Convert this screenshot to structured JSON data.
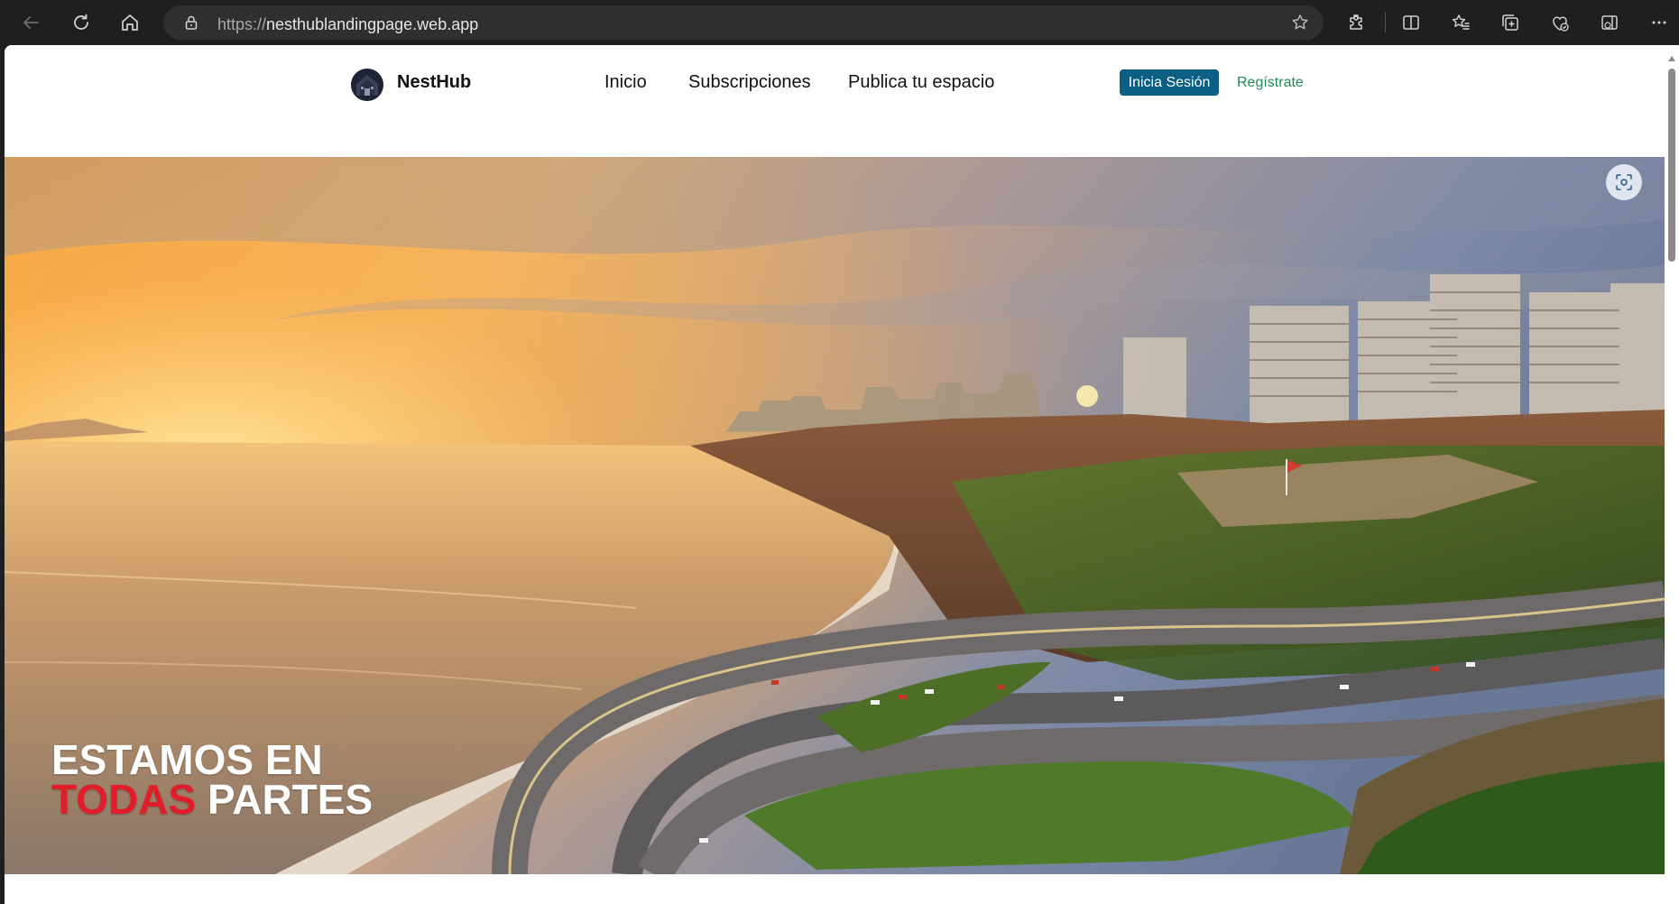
{
  "browser": {
    "url_protocol": "https://",
    "url_host": "nesthublandingpage.web.app",
    "icons": [
      "back-icon",
      "refresh-icon",
      "home-icon",
      "lock-icon",
      "star-icon",
      "extensions-icon",
      "split-screen-icon",
      "favorites-icon",
      "collections-icon",
      "browser-essentials-icon",
      "sidebar-icon",
      "more-icon"
    ]
  },
  "header": {
    "brand": "NestHub",
    "nav": [
      "Inicio",
      "Subscripciones",
      "Publica tu espacio"
    ],
    "login_label": "Inicia Sesión",
    "register_label": "Regístrate"
  },
  "hero": {
    "line1": "ESTAMOS EN",
    "line2_accent": "TODAS",
    "line2_rest": " PARTES"
  },
  "colors": {
    "login_bg": "#0b5f82",
    "register_text": "#1f8a5a",
    "hero_accent": "#e11d2a"
  }
}
